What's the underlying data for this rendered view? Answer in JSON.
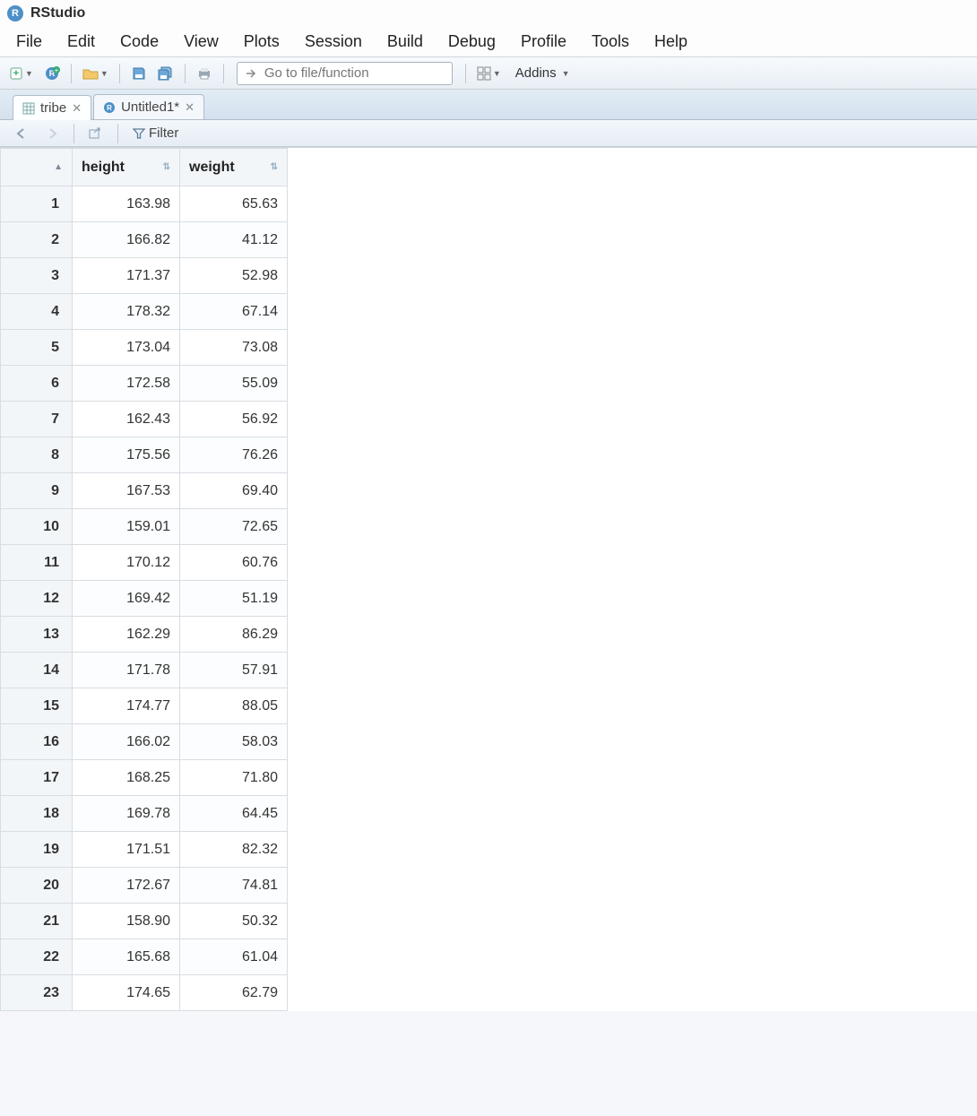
{
  "app": {
    "title": "RStudio"
  },
  "menu": {
    "items": [
      "File",
      "Edit",
      "Code",
      "View",
      "Plots",
      "Session",
      "Build",
      "Debug",
      "Profile",
      "Tools",
      "Help"
    ]
  },
  "toolbar": {
    "goto_placeholder": "Go to file/function",
    "addins_label": "Addins"
  },
  "tabs": {
    "items": [
      {
        "label": "tribe",
        "active": true,
        "dirty": false,
        "icon": "table"
      },
      {
        "label": "Untitled1*",
        "active": false,
        "dirty": true,
        "icon": "rscript"
      }
    ]
  },
  "subtoolbar": {
    "filter_label": "Filter"
  },
  "table": {
    "columns": [
      "height",
      "weight"
    ],
    "rows": [
      {
        "n": 1,
        "height": "163.98",
        "weight": "65.63"
      },
      {
        "n": 2,
        "height": "166.82",
        "weight": "41.12"
      },
      {
        "n": 3,
        "height": "171.37",
        "weight": "52.98"
      },
      {
        "n": 4,
        "height": "178.32",
        "weight": "67.14"
      },
      {
        "n": 5,
        "height": "173.04",
        "weight": "73.08"
      },
      {
        "n": 6,
        "height": "172.58",
        "weight": "55.09"
      },
      {
        "n": 7,
        "height": "162.43",
        "weight": "56.92"
      },
      {
        "n": 8,
        "height": "175.56",
        "weight": "76.26"
      },
      {
        "n": 9,
        "height": "167.53",
        "weight": "69.40"
      },
      {
        "n": 10,
        "height": "159.01",
        "weight": "72.65"
      },
      {
        "n": 11,
        "height": "170.12",
        "weight": "60.76"
      },
      {
        "n": 12,
        "height": "169.42",
        "weight": "51.19"
      },
      {
        "n": 13,
        "height": "162.29",
        "weight": "86.29"
      },
      {
        "n": 14,
        "height": "171.78",
        "weight": "57.91"
      },
      {
        "n": 15,
        "height": "174.77",
        "weight": "88.05"
      },
      {
        "n": 16,
        "height": "166.02",
        "weight": "58.03"
      },
      {
        "n": 17,
        "height": "168.25",
        "weight": "71.80"
      },
      {
        "n": 18,
        "height": "169.78",
        "weight": "64.45"
      },
      {
        "n": 19,
        "height": "171.51",
        "weight": "82.32"
      },
      {
        "n": 20,
        "height": "172.67",
        "weight": "74.81"
      },
      {
        "n": 21,
        "height": "158.90",
        "weight": "50.32"
      },
      {
        "n": 22,
        "height": "165.68",
        "weight": "61.04"
      },
      {
        "n": 23,
        "height": "174.65",
        "weight": "62.79"
      }
    ]
  }
}
